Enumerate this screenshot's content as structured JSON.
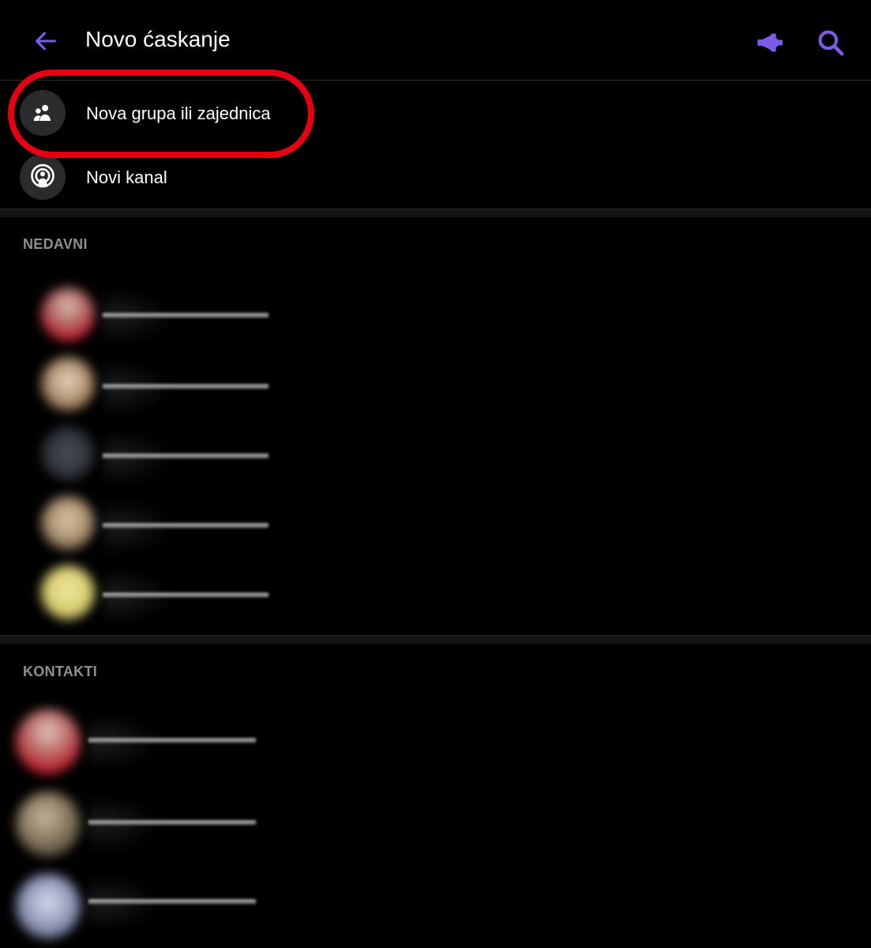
{
  "header": {
    "title": "Novo ćaskanje",
    "back_icon": "arrow-left-icon",
    "megaphone_icon": "megaphone-icon",
    "search_icon": "search-icon",
    "accent_color": "#7c5ce6"
  },
  "actions": [
    {
      "label": "Nova grupa ili zajednica",
      "icon": "group-icon",
      "highlighted": true
    },
    {
      "label": "Novi kanal",
      "icon": "channel-icon",
      "highlighted": false
    }
  ],
  "highlight_color": "#e60012",
  "sections": {
    "recent": {
      "title": "NEDAVNI"
    },
    "contacts": {
      "title": "KONTAKTI"
    }
  }
}
